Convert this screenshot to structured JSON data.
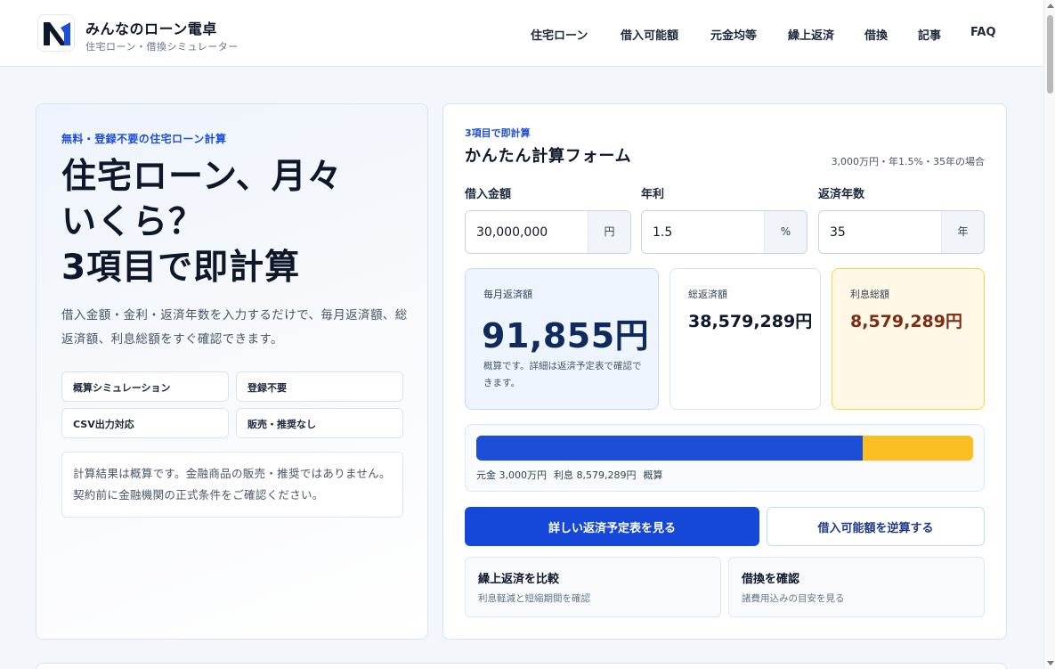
{
  "brand": {
    "name": "みんなのローン電卓",
    "subtitle": "住宅ローン・借換シミュレーター"
  },
  "nav": [
    {
      "label": "住宅ローン"
    },
    {
      "label": "借入可能額"
    },
    {
      "label": "元金均等"
    },
    {
      "label": "繰上返済"
    },
    {
      "label": "借換"
    },
    {
      "label": "記事"
    },
    {
      "label": "FAQ"
    }
  ],
  "hero": {
    "eyebrow": "無料・登録不要の住宅ローン計算",
    "title_line1": "住宅ローン、月々",
    "title_line2": "いくら？",
    "title_line3": "3項目で即計算",
    "lead": "借入金額・金利・返済年数を入力するだけで、毎月返済額、総返済額、利息総額をすぐ確認できます。",
    "tags": [
      "概算シミュレーション",
      "登録不要",
      "CSV出力対応",
      "販売・推奨なし"
    ],
    "note": "計算結果は概算です。金融商品の販売・推奨ではありません。契約前に金融機関の正式条件をご確認ください。"
  },
  "calculator": {
    "eyebrow": "3項目で即計算",
    "title": "かんたん計算フォーム",
    "example_hint": "3,000万円・年1.5%・35年の場合",
    "fields": {
      "amount": {
        "label": "借入金額",
        "value": "30,000,000",
        "unit": "円"
      },
      "rate": {
        "label": "年利",
        "value": "1.5",
        "unit": "%"
      },
      "years": {
        "label": "返済年数",
        "value": "35",
        "unit": "年"
      }
    },
    "results": {
      "monthly": {
        "label": "毎月返済額",
        "value": "91,855円",
        "note": "概算です。詳細は返済予定表で確認できます。"
      },
      "total": {
        "label": "総返済額",
        "value": "38,579,289円"
      },
      "interest": {
        "label": "利息総額",
        "value": "8,579,289円"
      }
    },
    "breakdown": {
      "principal_ratio": 0.7776,
      "principal_label": "元金 3,000万円",
      "interest_label": "利息 8,579,289円",
      "suffix": "概算",
      "colors": {
        "principal": "#1d4ed8",
        "interest": "#fbbf24"
      }
    },
    "primary_button": "詳しい返済予定表を見る",
    "secondary_button": "借入可能額を逆算する",
    "links": [
      {
        "title": "繰上返済を比較",
        "subtitle": "利息軽減と短縮期間を確認"
      },
      {
        "title": "借換を確認",
        "subtitle": "諸費用込みの目安を見る"
      }
    ]
  }
}
